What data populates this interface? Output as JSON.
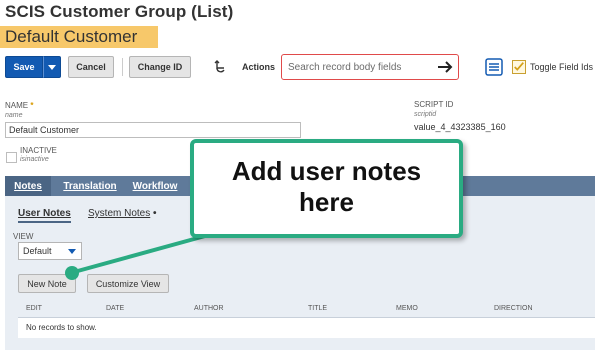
{
  "header": {
    "title": "SCIS Customer Group (List)",
    "record_name": "Default Customer"
  },
  "toolbar": {
    "save_label": "Save",
    "cancel_label": "Cancel",
    "change_id_label": "Change ID",
    "actions_label": "Actions",
    "search_placeholder": "Search record body fields",
    "toggle_label": "Toggle Field Ids",
    "toggle_checked": true
  },
  "fields": {
    "name_label": "NAME",
    "name_required_mark": "*",
    "name_sub": "name",
    "name_value": "Default Customer",
    "inactive_label": "INACTIVE",
    "inactive_sub": "isinactive",
    "inactive_checked": false,
    "script_id_label": "SCRIPT ID",
    "script_id_sub": "scriptid",
    "script_id_value": "value_4_4323385_160"
  },
  "tabs": [
    {
      "label": "Notes",
      "active": true
    },
    {
      "label": "Translation",
      "active": false
    },
    {
      "label": "Workflow",
      "active": false
    }
  ],
  "subtabs": [
    {
      "label": "User Notes",
      "active": true
    },
    {
      "label": "System Notes",
      "suffix": " •",
      "active": false
    }
  ],
  "notes": {
    "view_label": "VIEW",
    "view_value": "Default",
    "new_note_label": "New Note",
    "customize_view_label": "Customize View",
    "columns": [
      "EDIT",
      "DATE",
      "AUTHOR",
      "TITLE",
      "MEMO",
      "DIRECTION"
    ],
    "empty_message": "No records to show."
  },
  "callout": {
    "line1": "Add user notes",
    "line2": "here"
  },
  "colors": {
    "accent_blue": "#125ab2",
    "record_highlight": "#f7c86a",
    "tab_bar": "#5f7a9a",
    "callout_border": "#2aab82",
    "search_border": "#e04a4a"
  },
  "icons": {
    "undo": "undo-icon",
    "search_go": "arrow-right-icon",
    "list_view": "list-icon",
    "toggle": "checkbox-icon"
  }
}
